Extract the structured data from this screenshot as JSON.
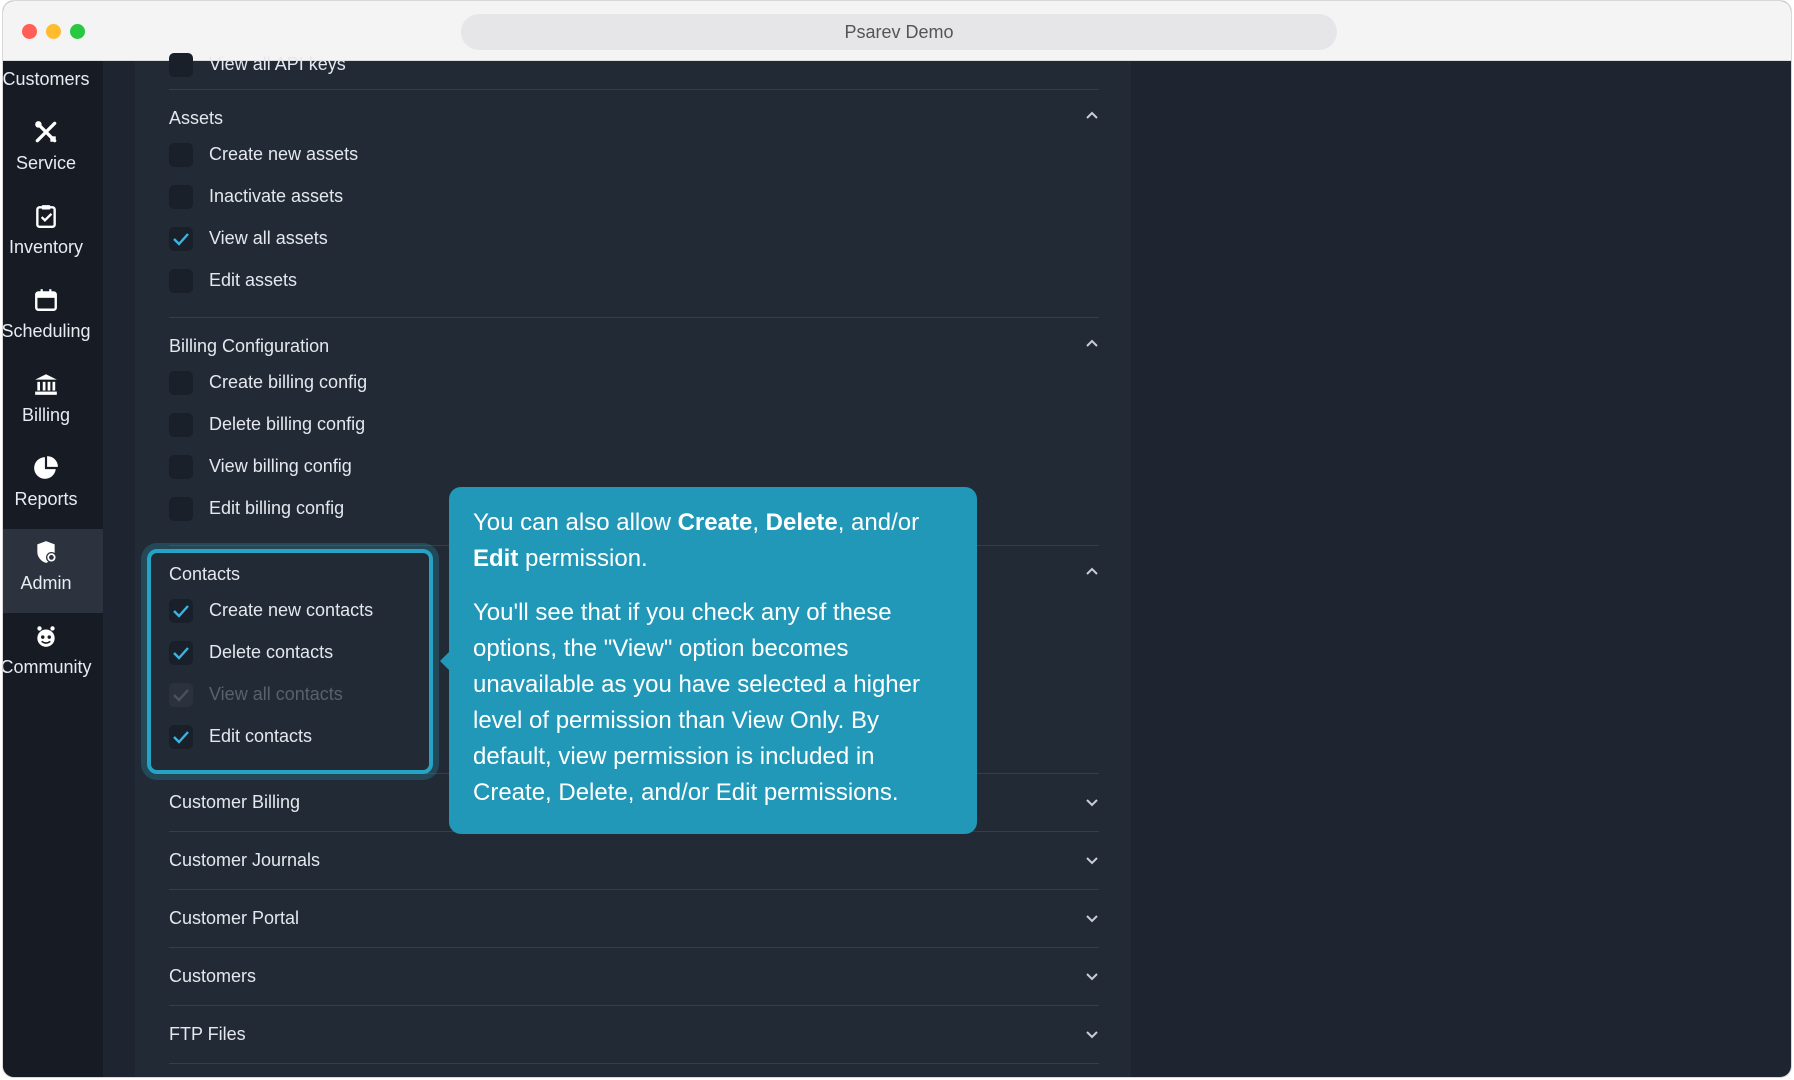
{
  "window": {
    "title": "Psarev Demo"
  },
  "sidebar": {
    "items": [
      {
        "label": "Customers",
        "icon": "customers-icon",
        "active": false
      },
      {
        "label": "Service",
        "icon": "tools-icon",
        "active": false
      },
      {
        "label": "Inventory",
        "icon": "clipboard-check-icon",
        "active": false
      },
      {
        "label": "Scheduling",
        "icon": "calendar-icon",
        "active": false
      },
      {
        "label": "Billing",
        "icon": "bank-icon",
        "active": false
      },
      {
        "label": "Reports",
        "icon": "pie-chart-icon",
        "active": false
      },
      {
        "label": "Admin",
        "icon": "shield-gear-icon",
        "active": true
      },
      {
        "label": "Community",
        "icon": "community-icon",
        "active": false
      }
    ]
  },
  "permissions": {
    "top_partial": {
      "label": "View all API keys",
      "checked": false
    },
    "assets": {
      "title": "Assets",
      "expanded": true,
      "items": [
        {
          "label": "Create new assets",
          "checked": false
        },
        {
          "label": "Inactivate assets",
          "checked": false
        },
        {
          "label": "View all assets",
          "checked": true
        },
        {
          "label": "Edit assets",
          "checked": false
        }
      ]
    },
    "billing_configuration": {
      "title": "Billing Configuration",
      "expanded": true,
      "items": [
        {
          "label": "Create billing config",
          "checked": false
        },
        {
          "label": "Delete billing config",
          "checked": false
        },
        {
          "label": "View billing config",
          "checked": false
        },
        {
          "label": "Edit billing config",
          "checked": false
        }
      ]
    },
    "contacts": {
      "title": "Contacts",
      "expanded": true,
      "items": [
        {
          "label": "Create new contacts",
          "checked": true
        },
        {
          "label": "Delete contacts",
          "checked": true
        },
        {
          "label": "View all contacts",
          "checked": true,
          "disabled": true
        },
        {
          "label": "Edit contacts",
          "checked": true
        }
      ]
    },
    "collapsed_sections": [
      "Customer Billing",
      "Customer Journals",
      "Customer Portal",
      "Customers",
      "FTP Files"
    ]
  },
  "callout": {
    "p1_pre": "You can also allow ",
    "p1_b1": "Create",
    "p1_sep1": ", ",
    "p1_b2": "Delete",
    "p1_sep2": ", and/or ",
    "p1_b3": "Edit",
    "p1_post": " permission.",
    "p2": "You'll see that if you check any of these options, the \"View\" option becomes unavailable as you have selected a higher level of permission than View Only. By default, view permission is included in Create, Delete, and/or Edit permissions."
  },
  "colors": {
    "accent": "#2298b8",
    "check": "#3db2e0",
    "sidebar_bg": "#171c24",
    "panel_bg": "#222a35"
  }
}
